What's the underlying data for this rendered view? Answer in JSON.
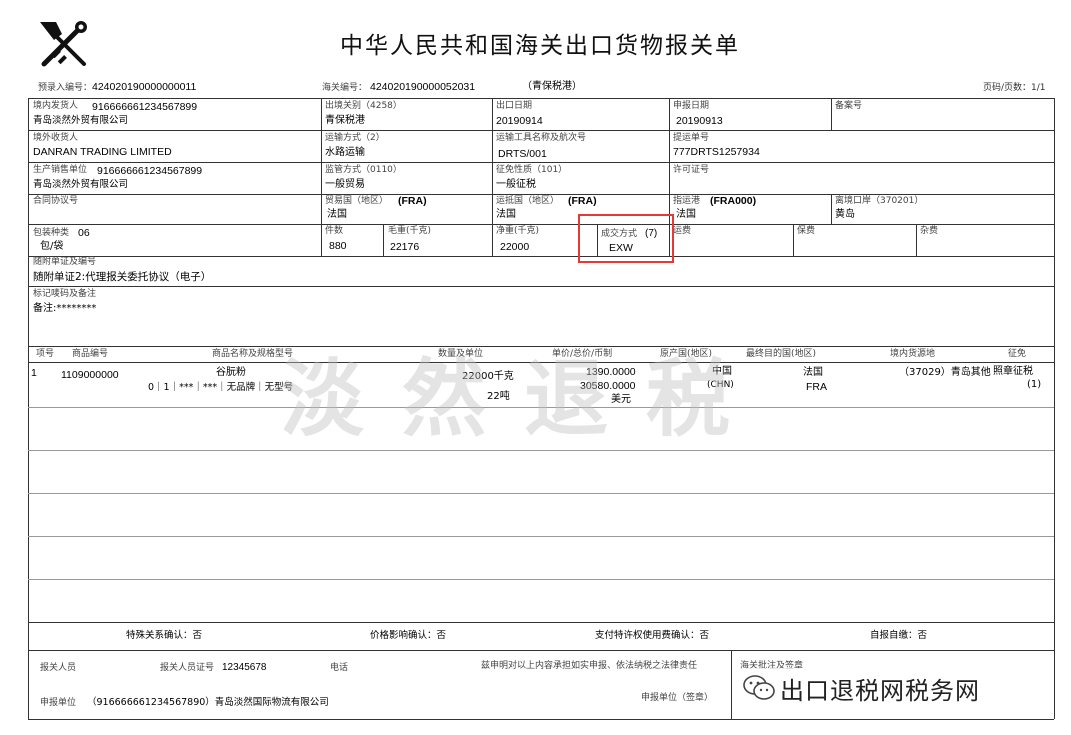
{
  "title": "中华人民共和国海关出口货物报关单",
  "header": {
    "pre_entry_label": "预录入编号：",
    "pre_entry_no": "424020190000000011",
    "customs_no_label": "海关编号：",
    "customs_no": "424020190000052031",
    "port_note": "（青保税港）",
    "page_label": "页码/页数：1/1"
  },
  "row1": {
    "consignor_label": "境内发货人",
    "consignor_code": "916666661234567899",
    "consignor_name": "青岛淡然外贸有限公司",
    "exit_customs_label": "出境关别（4258）",
    "exit_customs_value": "青保税港",
    "export_date_label": "出口日期",
    "export_date_value": "20190914",
    "declare_date_label": "申报日期",
    "declare_date_value": "20190913",
    "record_no_label": "备案号",
    "record_no_value": ""
  },
  "row2": {
    "consignee_label": "境外收货人",
    "consignee_value": "DANRAN TRADING LIMITED",
    "transport_mode_label": "运输方式（2）",
    "transport_mode_value": "水路运输",
    "conveyance_label": "运输工具名称及航次号",
    "conveyance_value": "DRTS/001",
    "bl_label": "提运单号",
    "bl_value": "777DRTS1257934"
  },
  "row3": {
    "producer_label": "生产销售单位",
    "producer_code": "916666661234567899",
    "producer_name": "青岛淡然外贸有限公司",
    "supervision_label": "监管方式（0110）",
    "supervision_value": "一般贸易",
    "levy_label": "征免性质（101）",
    "levy_value": "一般征税",
    "license_label": "许可证号",
    "license_value": ""
  },
  "row4": {
    "contract_label": "合同协议号",
    "contract_value": "",
    "trade_country_label": "贸易国（地区）",
    "trade_country_code": "(FRA)",
    "trade_country_value": "法国",
    "dest_country_label": "运抵国（地区）",
    "dest_country_code": "(FRA)",
    "dest_country_value": "法国",
    "dest_port_label": "指运港",
    "dest_port_code": "(FRA000)",
    "dest_port_value": "法国",
    "exit_port_label": "离境口岸（370201）",
    "exit_port_value": "黄岛"
  },
  "row5": {
    "package_label": "包装种类",
    "package_code": "06",
    "package_value": "包/袋",
    "pieces_label": "件数",
    "pieces_value": "880",
    "gross_label": "毛重(千克)",
    "gross_value": "22176",
    "net_label": "净重(千克)",
    "net_value": "22000",
    "terms_label": "成交方式",
    "terms_code": "(7)",
    "terms_value": "EXW",
    "freight_label": "运费",
    "insurance_label": "保费",
    "misc_label": "杂费"
  },
  "row6": {
    "docs_label": "随附单证及编号",
    "docs_value": "随附单证2:代理报关委托协议（电子）"
  },
  "row7": {
    "marks_label": "标记唛码及备注",
    "marks_value": "备注:********"
  },
  "goods_headers": [
    "项号",
    "商品编号",
    "商品名称及规格型号",
    "数量及单位",
    "单价/总价/币制",
    "原产国(地区)",
    "最终目的国(地区)",
    "境内货源地",
    "征免"
  ],
  "goods": [
    {
      "item": "1",
      "hs_code": "1109000000",
      "name": "谷朊粉",
      "spec": "0｜1｜***｜***｜无品牌｜无型号",
      "qty1": "22000千克",
      "qty2": "22吨",
      "unit_price": "1390.0000",
      "total_price": "30580.0000",
      "currency": "美元",
      "origin": "中国",
      "origin_code": "(CHN)",
      "dest": "法国",
      "dest_code": "FRA",
      "source": "（37029）青岛其他",
      "levy": "照章征税",
      "levy_code": "(1)"
    }
  ],
  "confirm": {
    "special_relation": "特殊关系确认：否",
    "price_influence": "价格影响确认：否",
    "royalty": "支付特许权使用费确认：否",
    "self_report": "自报自缴：否"
  },
  "footer": {
    "declarant_label": "报关人员",
    "declarant_cert_label": "报关人员证号",
    "declarant_cert_value": "12345678",
    "phone_label": "电话",
    "statement": "兹申明对以上内容承担如实申报、依法纳税之法律责任",
    "customs_sign_label": "海关批注及签章",
    "declare_unit_label": "申报单位",
    "declare_unit_value": "（916666661234567890）青岛淡然国际物流有限公司",
    "declare_unit_sign": "申报单位（签章）"
  },
  "watermark_text": "淡然退税",
  "wechat_text": "出口退税网税务网",
  "colors": {
    "highlight": "#e53935",
    "watermark": "#bfbfbf"
  },
  "icons": {
    "customs_emblem": "customs-emblem-icon",
    "wechat": "wechat-icon"
  }
}
